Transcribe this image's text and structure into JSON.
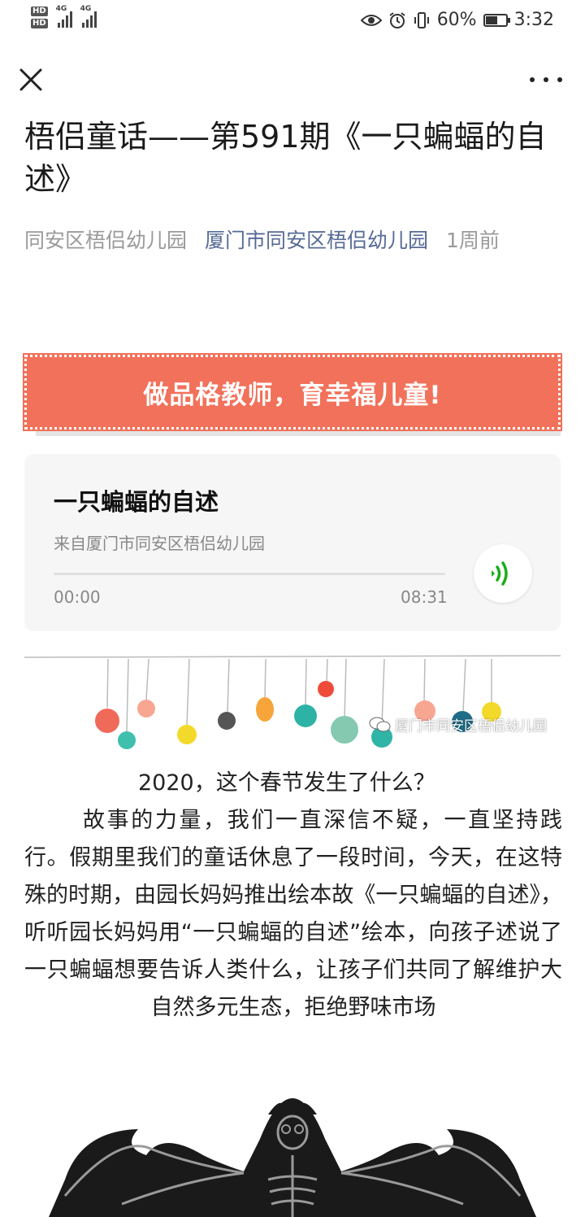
{
  "status_bar": {
    "sim1": "HD",
    "sim2": "HD",
    "net1": "4G",
    "net2": "4G",
    "battery_text": "60%",
    "battery_level": 0.6,
    "time": "3:32"
  },
  "nav": {
    "close_icon": "close-icon",
    "more_icon": "more-icon"
  },
  "article": {
    "title": "梧侣童话——第591期《一只蝙蝠的自述》",
    "org": "同安区梧侣幼儿园",
    "account": "厦门市同安区梧侣幼儿园",
    "time": "1周前"
  },
  "banner": {
    "text": "做品格教师，育幸福儿童!",
    "color": "#f2715a"
  },
  "audio": {
    "title": "一只蝙蝠的自述",
    "source": "来自厦门市同安区梧侣幼儿园",
    "current": "00:00",
    "duration": "08:31",
    "progress": 0,
    "accent": "#1aad19"
  },
  "watermark": {
    "text": "厦门市同安区梧侣幼儿园",
    "icon": "wechat-icon"
  },
  "content": {
    "p1": "2020，这个春节发生了什么？",
    "p2": "故事的力量，我们一直深信不疑，一直坚持践行。假期里我们的童话休息了一段时间，今天，在这特殊的时期，由园长妈妈推出绘本故《一只蝙蝠的自述》，听听园长妈妈用“一只蝙蝠的自述”绘本，向孩子述说了一只蝙蝠想要告诉人类什么，让孩子们共同了解维护大自然多元生态，拒绝野味市场"
  }
}
